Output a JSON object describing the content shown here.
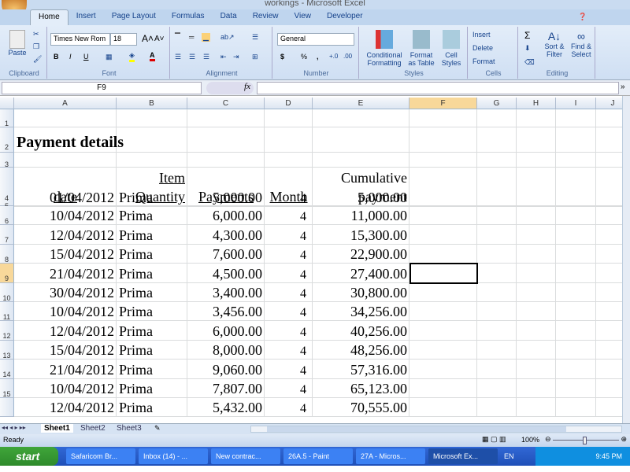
{
  "window": {
    "title": "workings - Microsoft Excel"
  },
  "ribbon_tabs": [
    "Home",
    "Insert",
    "Page Layout",
    "Formulas",
    "Data",
    "Review",
    "View",
    "Developer"
  ],
  "ribbon": {
    "clipboard": {
      "label": "Clipboard",
      "paste": "Paste"
    },
    "font": {
      "label": "Font",
      "name": "Times New Rom",
      "size": "18",
      "bold": "B",
      "italic": "I",
      "underline": "U"
    },
    "alignment": {
      "label": "Alignment"
    },
    "number": {
      "label": "Number",
      "format": "General",
      "currency": "$",
      "percent": "%",
      "comma": ","
    },
    "styles": {
      "label": "Styles",
      "conditional": "Conditional Formatting",
      "format_table": "Format as Table",
      "cell_styles": "Cell Styles"
    },
    "cells": {
      "label": "Cells",
      "insert": "Insert",
      "delete": "Delete",
      "format": "Format"
    },
    "editing": {
      "label": "Editing",
      "sum": "Σ",
      "sort": "Sort & Filter",
      "find": "Find & Select"
    }
  },
  "formula_bar": {
    "name_box": "F9",
    "fx": "fx",
    "value": ""
  },
  "columns": [
    "A",
    "B",
    "C",
    "D",
    "E",
    "F",
    "G",
    "H",
    "I",
    "J"
  ],
  "rows": [
    "1",
    "2",
    "3",
    "4",
    "5",
    "6",
    "7",
    "8",
    "9",
    "10",
    "11",
    "12",
    "13",
    "14",
    "15"
  ],
  "sheet": {
    "title": "Payment details",
    "headers": {
      "date": "date",
      "item1": "Item",
      "item2": "Quantity",
      "payments": "Payments",
      "month": "Month",
      "cum1": "Cumulative",
      "cum2": "payment"
    },
    "data": [
      [
        "01/04/2012",
        "Prima",
        "5,000.00",
        "4",
        "5,000.00"
      ],
      [
        "10/04/2012",
        "Prima",
        "6,000.00",
        "4",
        "11,000.00"
      ],
      [
        "12/04/2012",
        "Prima",
        "4,300.00",
        "4",
        "15,300.00"
      ],
      [
        "15/04/2012",
        "Prima",
        "7,600.00",
        "4",
        "22,900.00"
      ],
      [
        "21/04/2012",
        "Prima",
        "4,500.00",
        "4",
        "27,400.00"
      ],
      [
        "30/04/2012",
        "Prima",
        "3,400.00",
        "4",
        "30,800.00"
      ],
      [
        "10/04/2012",
        "Prima",
        "3,456.00",
        "4",
        "34,256.00"
      ],
      [
        "12/04/2012",
        "Prima",
        "6,000.00",
        "4",
        "40,256.00"
      ],
      [
        "15/04/2012",
        "Prima",
        "8,000.00",
        "4",
        "48,256.00"
      ],
      [
        "21/04/2012",
        "Prima",
        "9,060.00",
        "4",
        "57,316.00"
      ],
      [
        "10/04/2012",
        "Prima",
        "7,807.00",
        "4",
        "65,123.00"
      ],
      [
        "12/04/2012",
        "Prima",
        "5,432.00",
        "4",
        "70,555.00"
      ]
    ],
    "selected_cell": "F9"
  },
  "sheet_tabs": [
    "Sheet1",
    "Sheet2",
    "Sheet3"
  ],
  "status": {
    "ready": "Ready",
    "zoom": "100%"
  },
  "taskbar": {
    "start": "start",
    "items": [
      "Safaricom Br...",
      "Inbox (14) - ...",
      "New contrac...",
      "26A.5 - Paint",
      "27A - Micros...",
      "Microsoft Ex..."
    ],
    "lang": "EN",
    "time": "9:45 PM"
  }
}
